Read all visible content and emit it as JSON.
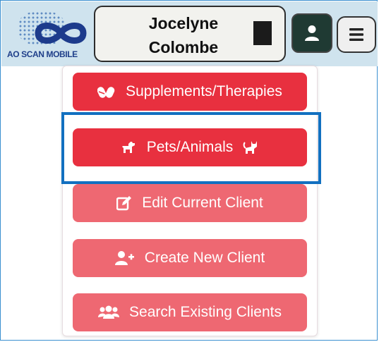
{
  "header": {
    "logo_text": "AO SCAN MOBILE",
    "client_name_line1": "Jocelyne",
    "client_name_line2": "Colombe"
  },
  "menu": {
    "items": [
      {
        "label": "Supplements/Therapies",
        "icon": "pills-icon"
      },
      {
        "label": "Pets/Animals",
        "icon": "dog-icon",
        "trailing_icon": "cat-icon"
      },
      {
        "label": "Edit Current Client",
        "icon": "edit-icon"
      },
      {
        "label": "Create New Client",
        "icon": "user-plus-icon"
      },
      {
        "label": "Search Existing Clients",
        "icon": "users-icon"
      }
    ],
    "highlighted_item": "Pets/Animals"
  },
  "colors": {
    "primary_red": "#e8303f",
    "light_red": "#ee6872",
    "highlight_blue": "#1270c0",
    "header_bg": "#cfe3ee"
  }
}
